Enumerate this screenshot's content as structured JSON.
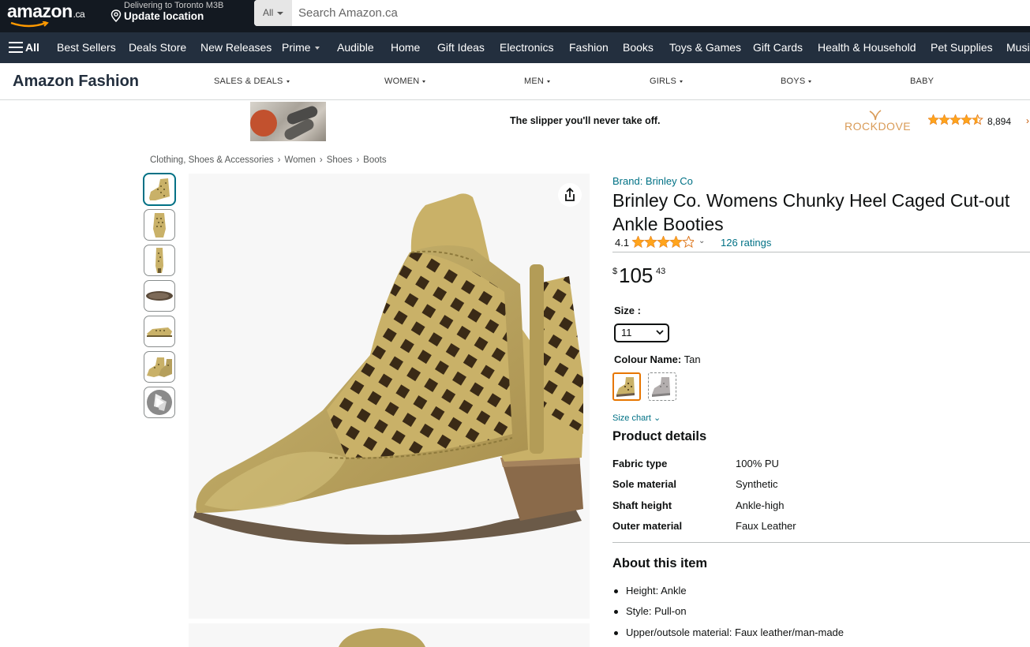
{
  "header": {
    "logo": "amazon",
    "logo_suffix": ".ca",
    "deliver_line1": "Delivering to Toronto M3B",
    "deliver_line2": "Update location",
    "search_category": "All",
    "search_placeholder": "Search Amazon.ca"
  },
  "nav": {
    "all_label": "All",
    "items": [
      "Best Sellers",
      "Deals Store",
      "New Releases",
      "Prime",
      "Audible",
      "Home",
      "Gift Ideas",
      "Electronics",
      "Fashion",
      "Books",
      "Toys & Games",
      "Gift Cards",
      "Health & Household",
      "Pet Supplies",
      "Music"
    ]
  },
  "fashion_nav": {
    "brand": "Amazon Fashion",
    "links": [
      "SALES & DEALS",
      "WOMEN",
      "MEN",
      "GIRLS",
      "BOYS",
      "BABY"
    ]
  },
  "ad": {
    "tagline": "The slipper you'll never take off.",
    "brand_logo": "ROCKDOVE",
    "rating_count": "8,894",
    "rating": 4.5
  },
  "breadcrumb": [
    "Clothing, Shoes & Accessories",
    "Women",
    "Shoes",
    "Boots"
  ],
  "product": {
    "brand_link": "Brand: Brinley Co",
    "title": "Brinley Co. Womens Chunky Heel Caged Cut-out Ankle Booties",
    "rating_value": "4.1",
    "rating": 4.1,
    "ratings_count": "126 ratings",
    "price_symbol": "$",
    "price_whole": "105",
    "price_fraction": "43",
    "size_label": "Size :",
    "size_selected": "11",
    "colour_label": "Colour Name:",
    "colour_value": "Tan",
    "size_chart": "Size chart"
  },
  "details": {
    "heading": "Product details",
    "rows": [
      {
        "key": "Fabric type",
        "value": "100% PU"
      },
      {
        "key": "Sole material",
        "value": "Synthetic"
      },
      {
        "key": "Shaft height",
        "value": "Ankle-high"
      },
      {
        "key": "Outer material",
        "value": "Faux Leather"
      }
    ]
  },
  "about": {
    "heading": "About this item",
    "bullets": [
      "Height: Ankle",
      "Style: Pull-on",
      "Upper/outsole material: Faux leather/man-made"
    ]
  },
  "colors": {
    "nav_dark": "#131921",
    "nav_light": "#232f3e",
    "link": "#007185",
    "star": "#ffa41c",
    "swatch_selected": "#e77600",
    "boot_tan": "#c9b168"
  }
}
